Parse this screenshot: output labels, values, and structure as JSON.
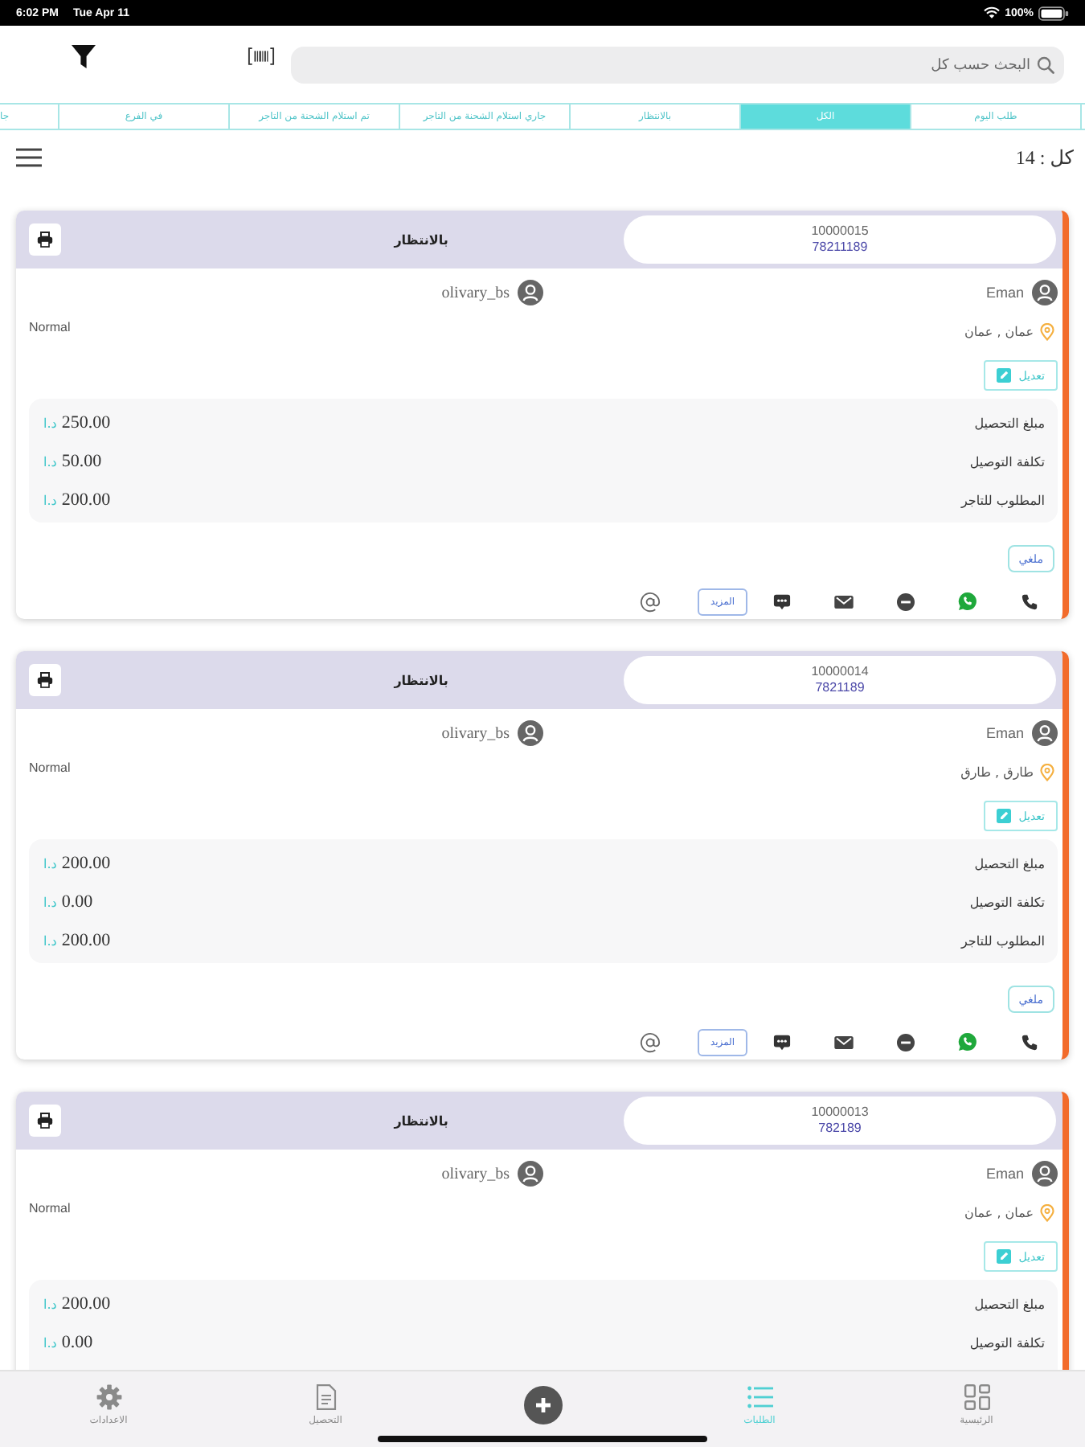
{
  "status_bar": {
    "time": "6:02 PM",
    "date": "Tue Apr 11",
    "battery": "100%"
  },
  "search": {
    "placeholder": "البحث حسب كل"
  },
  "tabs": [
    {
      "label": "طلب اليوم",
      "selected": false
    },
    {
      "label": "الكل",
      "selected": true
    },
    {
      "label": "بالانتظار",
      "selected": false
    },
    {
      "label": "جاري استلام الشحنة من التاجر",
      "selected": false
    },
    {
      "label": "تم استلام الشحنة من التاجر",
      "selected": false
    },
    {
      "label": "في الفرع",
      "selected": false
    },
    {
      "label": "جا",
      "selected": false
    }
  ],
  "count_label": "كل : 14",
  "orders": [
    {
      "number": "10000015",
      "phone": "78211189",
      "status": "بالانتظار",
      "customer": "Eman",
      "merchant": "olivary_bs",
      "type": "Normal",
      "location": "عمان , عمان",
      "edit_label": "تعديل",
      "amounts": [
        {
          "label": "مبلغ التحصيل",
          "currency": "د.ا",
          "value": "250.00"
        },
        {
          "label": "تكلفة التوصيل",
          "currency": "د.ا",
          "value": "50.00"
        },
        {
          "label": "المطلوب للتاجر",
          "currency": "د.ا",
          "value": "200.00"
        }
      ],
      "cancel_label": "ملغي",
      "more_label": "المزيد"
    },
    {
      "number": "10000014",
      "phone": "7821189",
      "status": "بالانتظار",
      "customer": "Eman",
      "merchant": "olivary_bs",
      "type": "Normal",
      "location": "طارق , طارق",
      "edit_label": "تعديل",
      "amounts": [
        {
          "label": "مبلغ التحصيل",
          "currency": "د.ا",
          "value": "200.00"
        },
        {
          "label": "تكلفة التوصيل",
          "currency": "د.ا",
          "value": "0.00"
        },
        {
          "label": "المطلوب للتاجر",
          "currency": "د.ا",
          "value": "200.00"
        }
      ],
      "cancel_label": "ملغي",
      "more_label": "المزيد"
    },
    {
      "number": "10000013",
      "phone": "782189",
      "status": "بالانتظار",
      "customer": "Eman",
      "merchant": "olivary_bs",
      "type": "Normal",
      "location": "عمان , عمان",
      "edit_label": "تعديل",
      "amounts": [
        {
          "label": "مبلغ التحصيل",
          "currency": "د.ا",
          "value": "200.00"
        },
        {
          "label": "تكلفة التوصيل",
          "currency": "د.ا",
          "value": "0.00"
        }
      ]
    }
  ],
  "bottom_nav": [
    {
      "kind": "home",
      "label": "الرئيسية",
      "selected": false
    },
    {
      "kind": "orders",
      "label": "الطلبات",
      "selected": true
    },
    {
      "kind": "add",
      "selected": false
    },
    {
      "kind": "collection",
      "label": "التحصيل",
      "selected": false
    },
    {
      "kind": "settings",
      "label": "الاعدادات",
      "selected": false
    }
  ]
}
